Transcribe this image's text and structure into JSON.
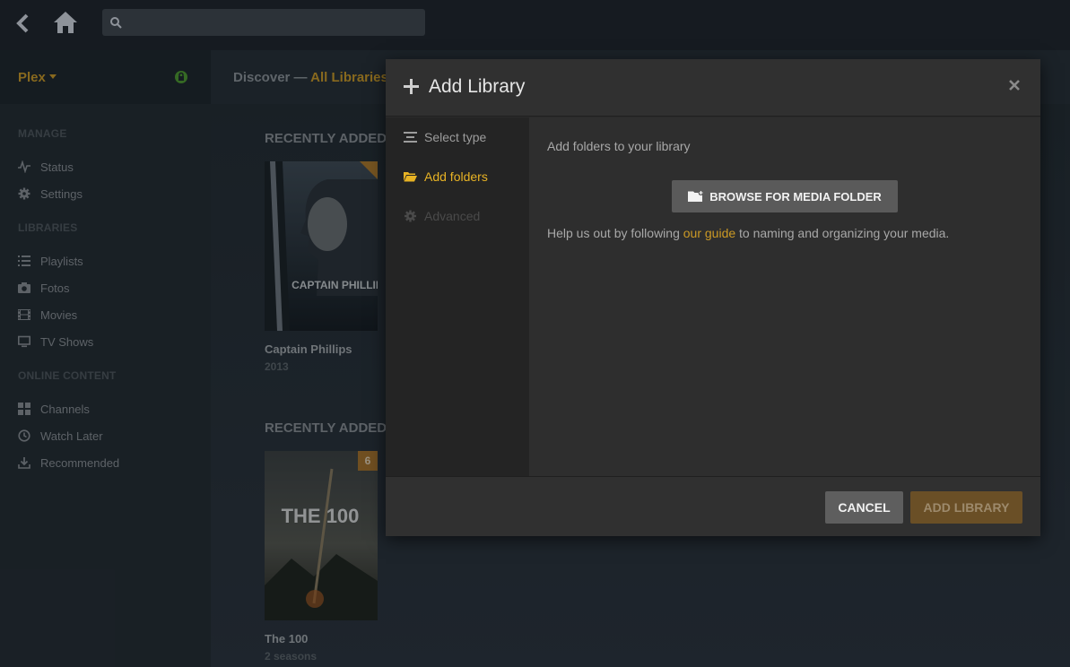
{
  "topbar": {
    "search_placeholder": ""
  },
  "sidebar": {
    "server": "Plex",
    "sections": {
      "manage": "MANAGE",
      "libraries": "LIBRARIES",
      "online": "ONLINE CONTENT"
    },
    "manage_items": [
      {
        "label": "Status",
        "icon": "pulse-icon"
      },
      {
        "label": "Settings",
        "icon": "gear-icon"
      }
    ],
    "library_items": [
      {
        "label": "Playlists",
        "icon": "list-icon"
      },
      {
        "label": "Fotos",
        "icon": "camera-icon"
      },
      {
        "label": "Movies",
        "icon": "film-icon"
      },
      {
        "label": "TV Shows",
        "icon": "monitor-icon"
      }
    ],
    "online_items": [
      {
        "label": "Channels",
        "icon": "grid-icon"
      },
      {
        "label": "Watch Later",
        "icon": "clock-icon"
      },
      {
        "label": "Recommended",
        "icon": "download-icon"
      }
    ]
  },
  "main": {
    "breadcrumb": {
      "discover": "Discover",
      "separator": " — ",
      "current": "All Libraries"
    },
    "hubs": [
      {
        "title": "RECENTLY ADDED",
        "item_title": "Captain Phillips",
        "item_sub": "2013",
        "poster_text": "CAPTAIN PHILLIPS"
      },
      {
        "title": "RECENTLY ADDED",
        "item_title": "The 100",
        "item_sub": "2 seasons",
        "badge": "6",
        "poster_text": "THE 100"
      }
    ]
  },
  "modal": {
    "title": "Add Library",
    "steps": [
      {
        "label": "Select type",
        "state": "done"
      },
      {
        "label": "Add folders",
        "state": "active"
      },
      {
        "label": "Advanced",
        "state": "disabled"
      }
    ],
    "heading": "Add folders to your library",
    "browse_label": "BROWSE FOR MEDIA FOLDER",
    "help_before": "Help us out by following ",
    "help_link": "our guide",
    "help_after": " to naming and organizing your media.",
    "cancel_label": "CANCEL",
    "add_label": "ADD LIBRARY"
  },
  "colors": {
    "accent": "#cc9a25",
    "topbar": "#161b21",
    "sidebar": "#232a31",
    "modal": "#2b2b2b"
  }
}
